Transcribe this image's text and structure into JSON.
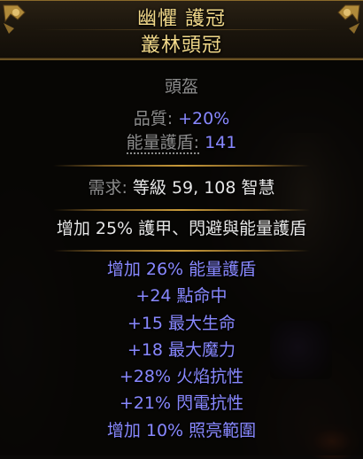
{
  "item": {
    "name": "幽懼 護冠",
    "base_type": "叢林頭冠",
    "item_class": "頭盔",
    "quality": {
      "label": "品質:",
      "value": "+20%"
    },
    "energy_shield": {
      "label": "能量護盾:",
      "value": "141"
    },
    "requirements": {
      "label": "需求:",
      "text": "等級 59, 108 智慧"
    },
    "implicit_mod": "增加 25% 護甲、閃避與能量護盾",
    "explicit_mods": [
      "增加 26% 能量護盾",
      "+24 點命中",
      "+15 最大生命",
      "+18 最大魔力",
      "+28% 火焰抗性",
      "+21% 閃電抗性",
      "增加 10% 照亮範圍"
    ]
  },
  "colors": {
    "title": "#f2d98a",
    "magic": "#8888ff",
    "label": "#8c8c8c",
    "white": "#e6e6e6",
    "border_gold": "#c89a3a"
  }
}
